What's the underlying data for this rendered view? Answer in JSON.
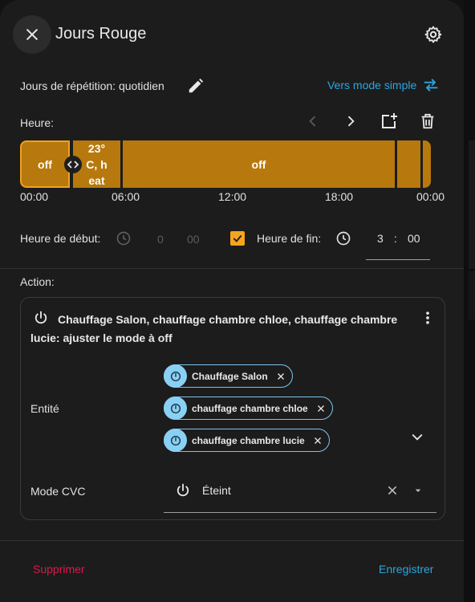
{
  "dialog": {
    "title": "Jours Rouge"
  },
  "repeat": {
    "label": "Jours de répétition: quotidien",
    "simple_mode_link": "Vers mode simple"
  },
  "hour": {
    "label": "Heure:",
    "segments": [
      {
        "label": "off"
      },
      {
        "label": "23° C, h eat",
        "line1": "23°",
        "line2": "C, h",
        "line3": "eat"
      },
      {
        "label": "off"
      },
      {
        "label": ""
      },
      {
        "label": ""
      }
    ],
    "ticks": [
      "00:00",
      "06:00",
      "12:00",
      "18:00",
      "00:00"
    ]
  },
  "time_fields": {
    "start_label": "Heure de début:",
    "start_hour": "0",
    "start_minute": "00",
    "end_checkbox_checked": true,
    "end_label": "Heure de fin:",
    "end_hour": "3",
    "separator": ":",
    "end_minute": "00"
  },
  "action": {
    "label": "Action:",
    "card_title": "Chauffage Salon, chauffage chambre chloe, chauffage chambre lucie: ajuster le mode à off",
    "entity_label": "Entité",
    "entities": [
      {
        "name": "Chauffage Salon"
      },
      {
        "name": "chauffage chambre chloe"
      },
      {
        "name": "chauffage chambre lucie"
      }
    ],
    "mode_label": "Mode CVC",
    "mode_value": "Éteint"
  },
  "footer": {
    "delete_label": "Supprimer",
    "save_label": "Enregistrer"
  },
  "colors": {
    "accent": "#2ba6e0",
    "segment": "#b7790d",
    "checkbox": "#f5a51c",
    "danger": "#e0174a",
    "chip_avatar": "#8ad0f5"
  },
  "icons": [
    "close-icon",
    "gear-icon",
    "pencil-icon",
    "swap-icon",
    "chevron-left-icon",
    "chevron-right-icon",
    "add-box-icon",
    "trash-icon",
    "resize-handle-icon",
    "clock-icon",
    "check-icon",
    "power-icon",
    "more-vertical-icon",
    "thermostat-icon",
    "chip-close-icon",
    "chevron-down-icon",
    "dropdown-arrow-icon"
  ]
}
